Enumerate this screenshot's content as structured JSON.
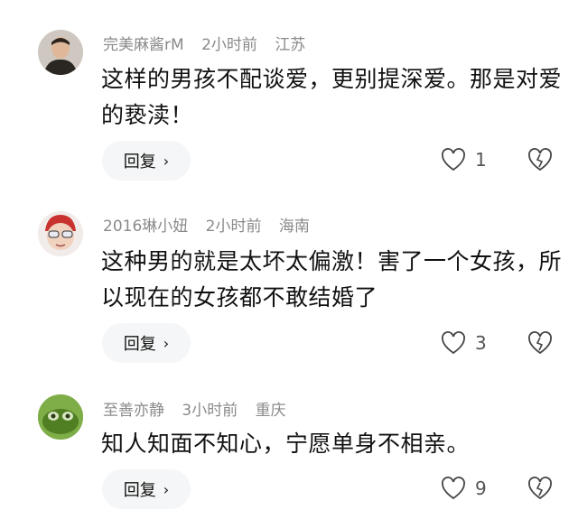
{
  "comments": [
    {
      "user": "完美麻酱rM",
      "time": "2小时前",
      "location": "江苏",
      "text": "这样的男孩不配谈爱，更别提深爱。那是对爱的亵渎！",
      "reply_label": "回复",
      "likes": "1",
      "avatar_icon": "user-avatar-man",
      "avatar_color": "#3a2e25"
    },
    {
      "user": "2016琳小妞",
      "time": "2小时前",
      "location": "海南",
      "text": "这种男的就是太坏太偏激！害了一个女孩，所以现在的女孩都不敢结婚了",
      "reply_label": "回复",
      "likes": "3",
      "avatar_icon": "user-avatar-sunglasses",
      "avatar_color": "#c8332f"
    },
    {
      "user": "至善亦静",
      "time": "3小时前",
      "location": "重庆",
      "text": "知人知面不知心，宁愿单身不相亲。",
      "reply_label": "回复",
      "likes": "9",
      "avatar_icon": "user-avatar-green",
      "avatar_color": "#5e8f2c"
    }
  ]
}
